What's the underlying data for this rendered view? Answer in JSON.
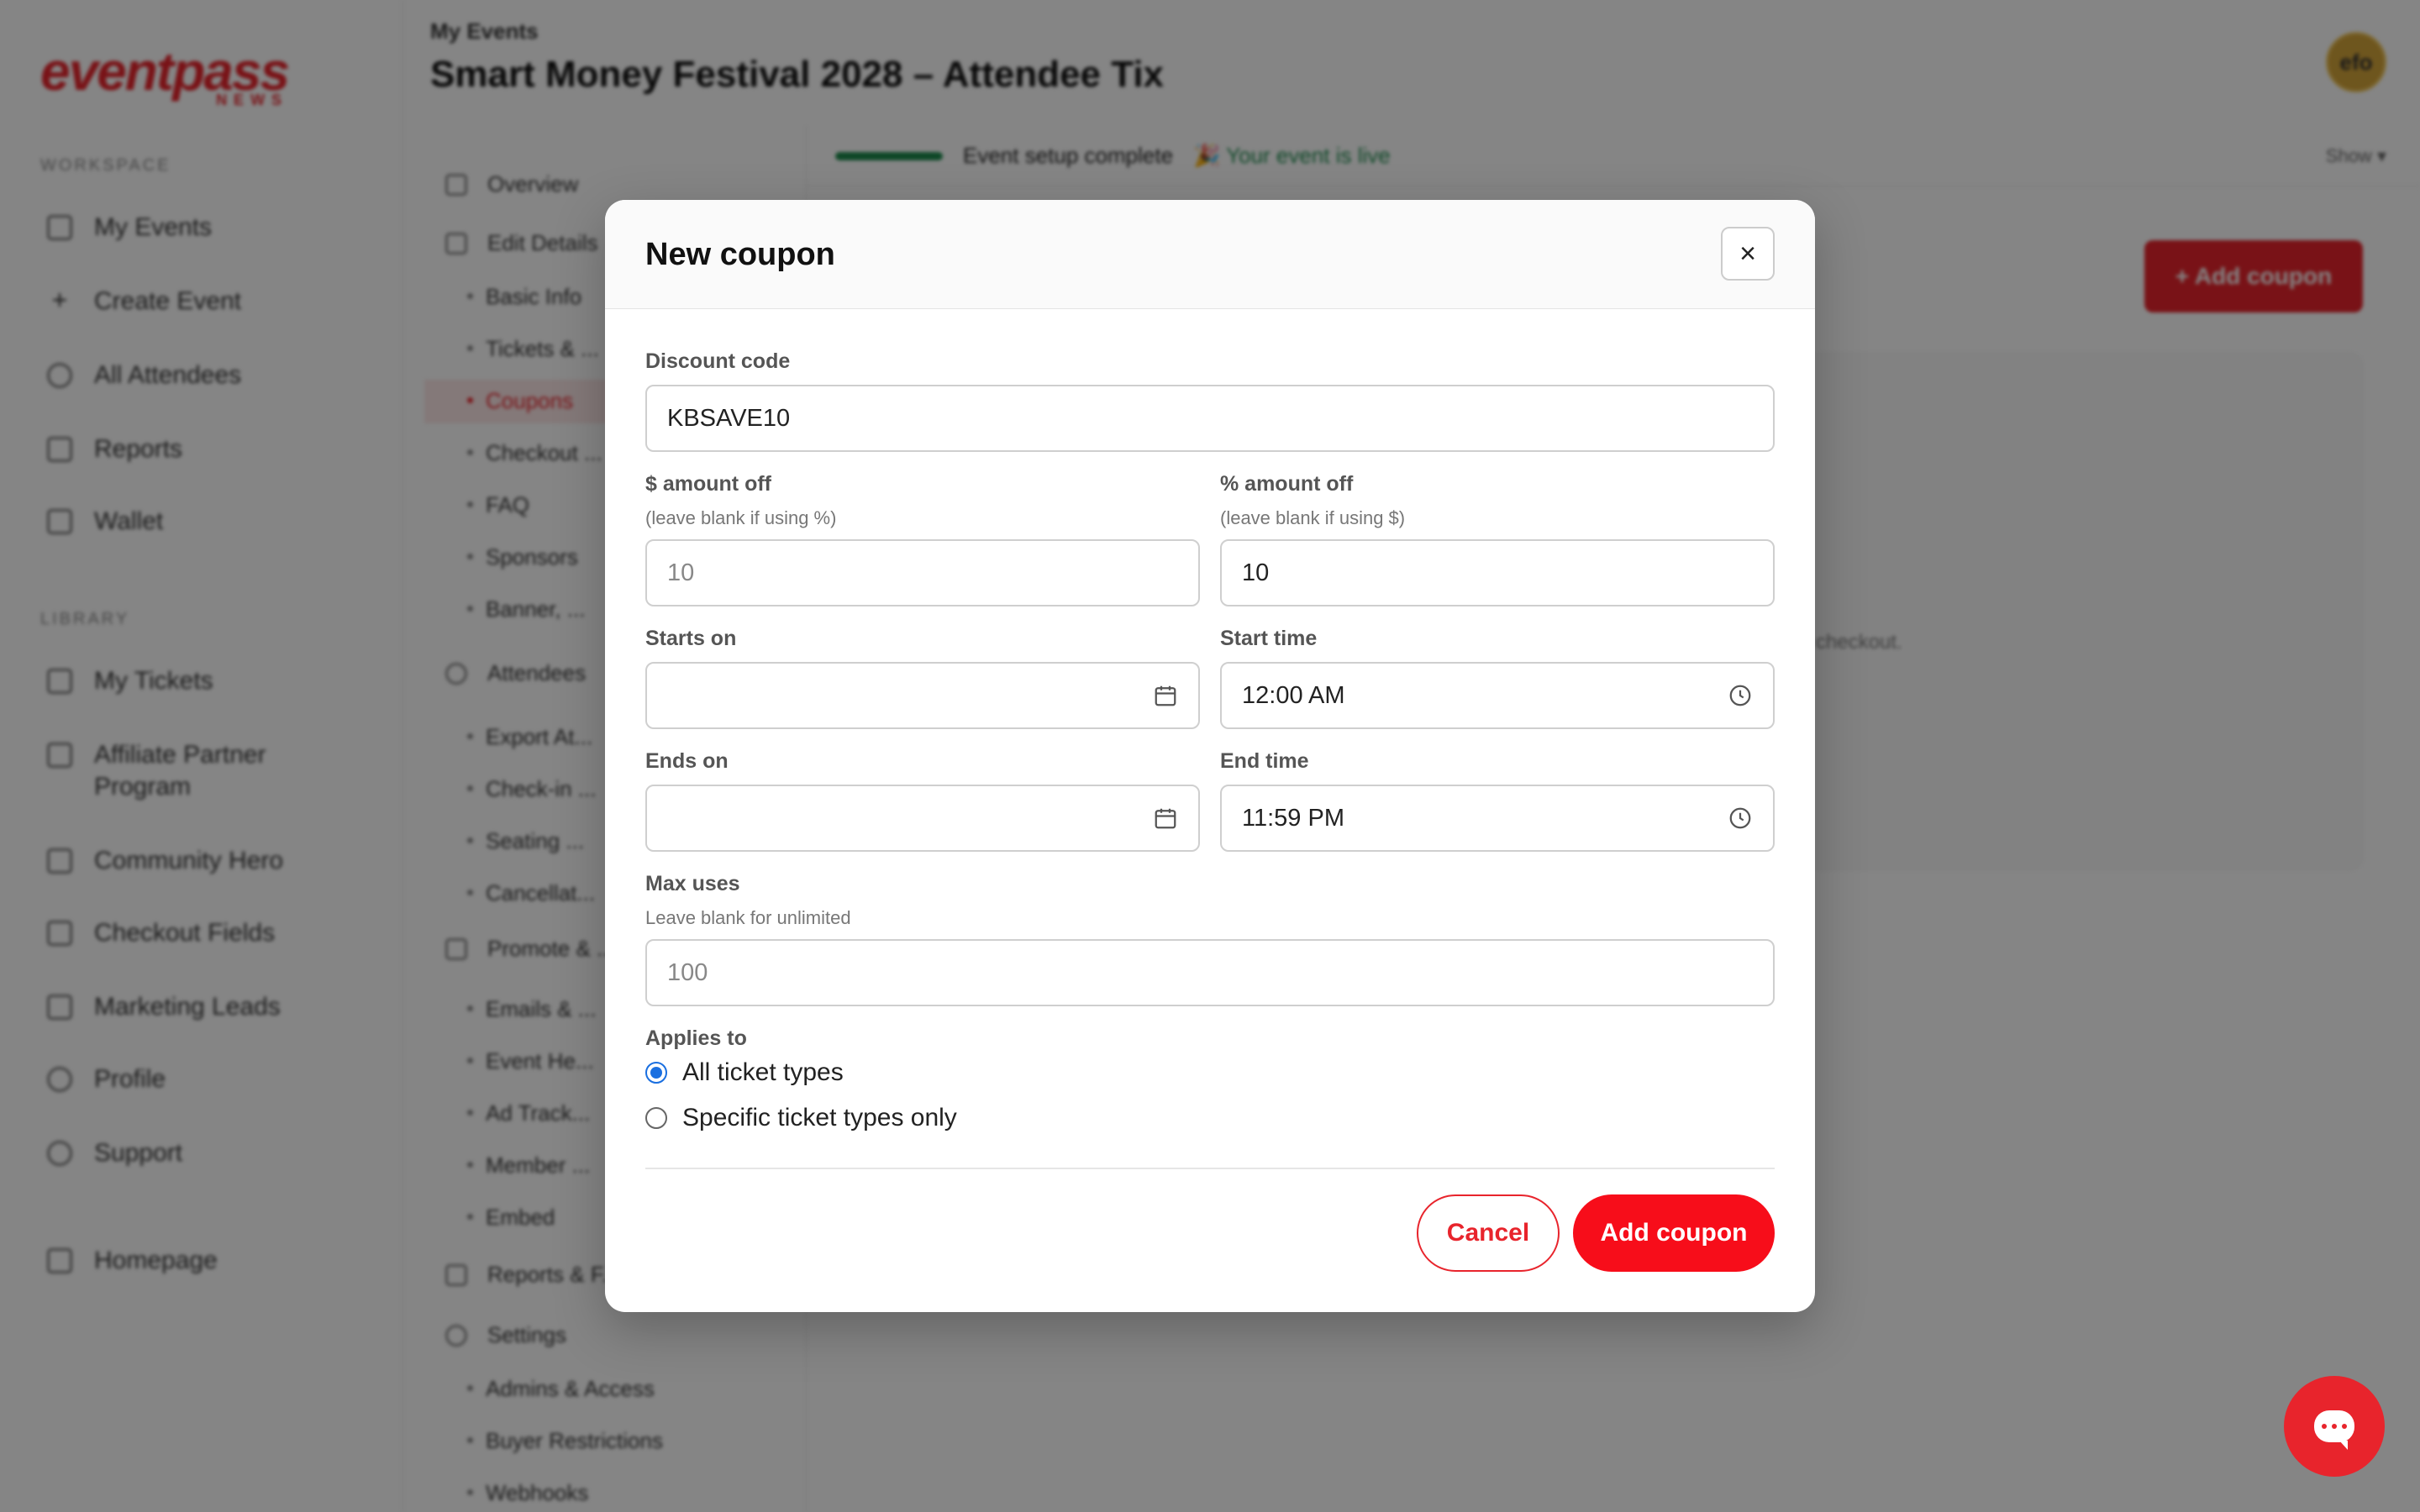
{
  "app": {
    "logo_text": "eventpass",
    "logo_sub": "NEWS",
    "breadcrumb": "My Events",
    "page_title": "Smart Money Festival 2028 – Attendee Tix",
    "avatar_initials": "efo"
  },
  "sidebar": {
    "workspace_label": "WORKSPACE",
    "library_label": "LIBRARY",
    "workspace_items": [
      {
        "label": "My Events",
        "icon": "calendar-icon"
      },
      {
        "label": "Create Event",
        "icon": "plus-icon"
      },
      {
        "label": "All Attendees",
        "icon": "users-icon"
      },
      {
        "label": "Reports",
        "icon": "chart-icon"
      },
      {
        "label": "Wallet",
        "icon": "wallet-icon"
      }
    ],
    "library_items": [
      {
        "label": "My Tickets",
        "icon": "ticket-icon"
      },
      {
        "label": "Affiliate Partner Program",
        "icon": "trophy-icon"
      },
      {
        "label": "Community Hero",
        "icon": "megaphone-icon"
      },
      {
        "label": "Checkout Fields",
        "icon": "clipboard-icon"
      },
      {
        "label": "Marketing Leads",
        "icon": "mail-icon"
      },
      {
        "label": "Profile",
        "icon": "user-icon"
      },
      {
        "label": "Support",
        "icon": "support-icon"
      },
      {
        "label": "Homepage",
        "icon": "home-icon"
      }
    ]
  },
  "subnav": {
    "overview": "Overview",
    "edit_details": "Edit Details",
    "edit_items": [
      "Basic Info",
      "Tickets & ...",
      "Coupons",
      "Checkout ...",
      "FAQ",
      "Sponsors",
      "Banner, ..."
    ],
    "attendees": "Attendees",
    "attendee_items": [
      "Export At...",
      "Check-in ...",
      "Seating ...",
      "Cancellat..."
    ],
    "promote": "Promote & ...",
    "promote_items": [
      "Emails & ...",
      "Event He...",
      "Ad Track...",
      "Member ...",
      "Embed"
    ],
    "reports": "Reports & F...",
    "settings": "Settings",
    "settings_items": [
      "Admins & Access",
      "Buyer Restrictions",
      "Webhooks"
    ]
  },
  "status": {
    "setup_text": "Event setup complete",
    "live_text": "🎉 Your event is live",
    "show_label": "Show",
    "progress": 1.0
  },
  "background": {
    "add_coupon_label": "+ Add coupon",
    "card_hint": "checkout."
  },
  "modal": {
    "title": "New coupon",
    "close_label": "×",
    "discount_code": {
      "label": "Discount code",
      "value": "KBSAVE10"
    },
    "dollar_off": {
      "label": "$ amount off",
      "hint": "(leave blank if using %)",
      "placeholder": "10",
      "value": ""
    },
    "percent_off": {
      "label": "% amount off",
      "hint": "(leave blank if using $)",
      "value": "10"
    },
    "starts_on": {
      "label": "Starts on",
      "value": ""
    },
    "start_time": {
      "label": "Start time",
      "value": "12:00 AM"
    },
    "ends_on": {
      "label": "Ends on",
      "value": ""
    },
    "end_time": {
      "label": "End time",
      "value": "11:59 PM"
    },
    "max_uses": {
      "label": "Max uses",
      "hint": "Leave blank for unlimited",
      "placeholder": "100",
      "value": ""
    },
    "applies_to": {
      "label": "Applies to",
      "options": [
        {
          "label": "All ticket types",
          "selected": true
        },
        {
          "label": "Specific ticket types only",
          "selected": false
        }
      ]
    },
    "cancel_label": "Cancel",
    "submit_label": "Add coupon"
  },
  "colors": {
    "brand_red": "#e8242c",
    "button_red": "#f70d1a",
    "radio_blue": "#1a6fe0",
    "success_green": "#1c8a4c"
  }
}
